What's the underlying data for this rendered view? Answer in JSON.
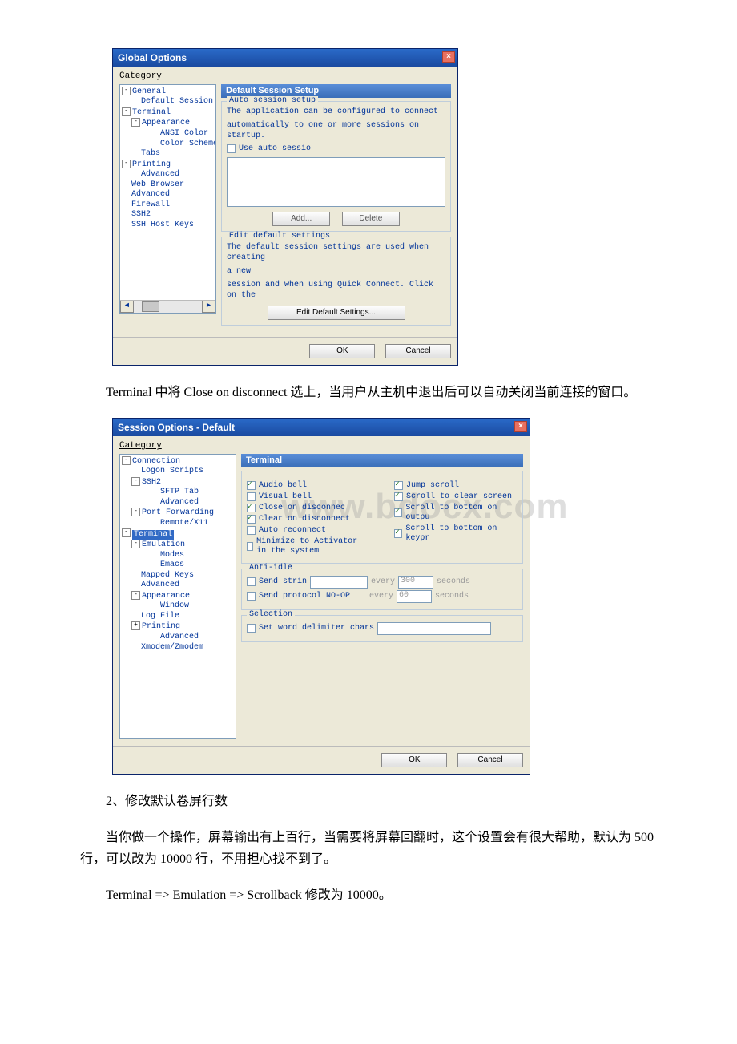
{
  "dialog1": {
    "title": "Global Options",
    "category_label": "Category",
    "tree": {
      "general": "General",
      "default_session": "Default Session",
      "terminal": "Terminal",
      "appearance": "Appearance",
      "ansi_color": "ANSI Color",
      "color_schemes": "Color Schemes",
      "tabs": "Tabs",
      "printing": "Printing",
      "advanced": "Advanced",
      "web_browser": "Web Browser",
      "advanced2": "Advanced",
      "firewall": "Firewall",
      "ssh2": "SSH2",
      "ssh_host_keys": "SSH Host Keys"
    },
    "panel_title": "Default Session Setup",
    "group_auto": "Auto session setup",
    "auto_desc1": "The application can be configured to connect",
    "auto_desc2": "automatically to one or more sessions on startup.",
    "chk_use_auto": "Use auto sessio",
    "btn_add": "Add...",
    "btn_delete": "Delete",
    "group_edit": "Edit default settings",
    "edit_desc1": "The default session settings are used when creating",
    "edit_desc2": "a new",
    "edit_desc3": "session and when using Quick Connect.  Click on the",
    "btn_edit_default": "Edit Default Settings...",
    "btn_ok": "OK",
    "btn_cancel": "Cancel"
  },
  "para1": "Terminal 中将 Close on disconnect 选上，当用户从主机中退出后可以自动关闭当前连接的窗口。",
  "dialog2": {
    "title": "Session Options - Default",
    "category_label": "Category",
    "tree": {
      "connection": "Connection",
      "logon_scripts": "Logon Scripts",
      "ssh2": "SSH2",
      "sftp_tab": "SFTP Tab",
      "advanced": "Advanced",
      "port_forwarding": "Port Forwarding",
      "remote_x11": "Remote/X11",
      "terminal": "Terminal",
      "emulation": "Emulation",
      "modes": "Modes",
      "emacs": "Emacs",
      "mapped_keys": "Mapped Keys",
      "advanced2": "Advanced",
      "appearance": "Appearance",
      "window": "Window",
      "log_file": "Log File",
      "printing": "Printing",
      "advanced3": "Advanced",
      "xmodem": "Xmodem/Zmodem"
    },
    "panel_title": "Terminal",
    "watermark": "www.bdocx.com",
    "chk_audio_bell": "Audio bell",
    "chk_visual_bell": "Visual bell",
    "chk_close_disconnect": "Close on disconnec",
    "chk_clear_disconnect": "Clear on disconnect",
    "chk_auto_reconnect": "Auto reconnect",
    "chk_minimize": "Minimize to Activator in the system",
    "chk_jump_scroll": "Jump scroll",
    "chk_scroll_clear": "Scroll to clear screen",
    "chk_scroll_bottom_out": "Scroll to bottom on outpu",
    "chk_scroll_bottom_key": "Scroll to bottom on keypr",
    "group_anti": "Anti-idle",
    "chk_send_string": "Send strin",
    "lbl_every1": "every",
    "val_every1": "300",
    "lbl_seconds": "seconds",
    "chk_send_protocol": "Send protocol NO-OP",
    "lbl_every2": "every",
    "val_every2": "60",
    "lbl_seconds2": "seconds",
    "group_selection": "Selection",
    "chk_word_delim": "Set word delimiter chars",
    "btn_ok": "OK",
    "btn_cancel": "Cancel"
  },
  "para2": "2、修改默认卷屏行数",
  "para3": "当你做一个操作，屏幕输出有上百行，当需要将屏幕回翻时，这个设置会有很大帮助，默认为 500 行，可以改为 10000 行，不用担心找不到了。",
  "para4": "Terminal => Emulation => Scrollback 修改为 10000。"
}
